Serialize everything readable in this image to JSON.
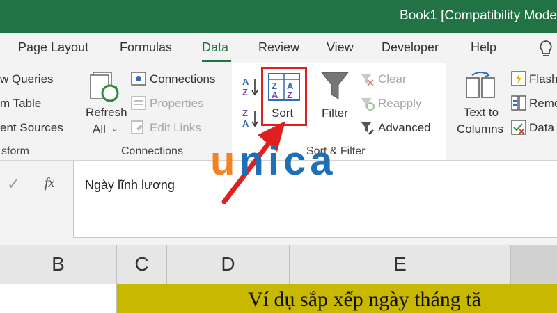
{
  "window": {
    "title": "Book1  [Compatibility Mode"
  },
  "tabs": [
    "Page Layout",
    "Formulas",
    "Data",
    "Review",
    "View",
    "Developer",
    "Help"
  ],
  "active_tab": "Data",
  "ribbon": {
    "get_transform": {
      "items": [
        "w Queries",
        "m Table",
        "ent Sources"
      ],
      "group_label": "sform"
    },
    "queries": {
      "refresh_label": "Refresh",
      "refresh_all_label": "All",
      "connections": "Connections",
      "properties": "Properties",
      "edit_links": "Edit Links",
      "group_label": "Connections"
    },
    "sort_filter": {
      "sort_label": "Sort",
      "filter_label": "Filter",
      "clear": "Clear",
      "reapply": "Reapply",
      "advanced": "Advanced",
      "group_label": "Sort & Filter"
    },
    "data_tools": {
      "text_to_columns_1": "Text to",
      "text_to_columns_2": "Columns",
      "flash": "Flash",
      "remove": "Remo",
      "data_val": "Data"
    }
  },
  "formula_bar": {
    "fx": "fx",
    "value": "Ngày lĩnh lương"
  },
  "columns": [
    "B",
    "C",
    "D",
    "E"
  ],
  "cell_text": "Ví dụ sắp xếp ngày tháng tă",
  "watermark": "unica",
  "colors": {
    "excel_green": "#217346",
    "highlight_red": "#e0201f",
    "watermark_orange": "#f58220",
    "watermark_blue": "#1f6fb5"
  }
}
